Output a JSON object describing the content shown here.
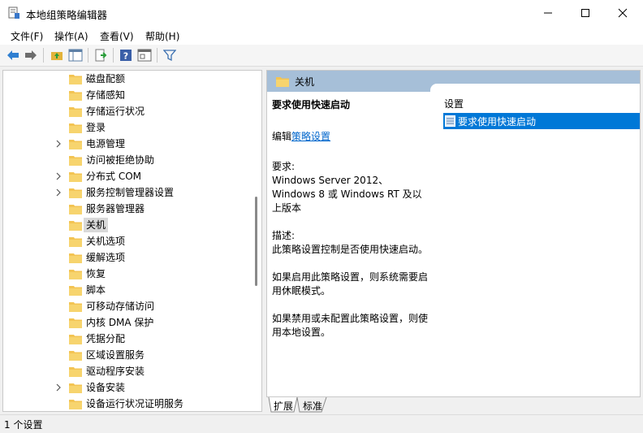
{
  "window": {
    "title": "本地组策略编辑器"
  },
  "menu": [
    {
      "label": "文件(F)"
    },
    {
      "label": "操作(A)"
    },
    {
      "label": "查看(V)"
    },
    {
      "label": "帮助(H)"
    }
  ],
  "tree": {
    "items": [
      {
        "label": "磁盘配额",
        "expandable": false
      },
      {
        "label": "存储感知",
        "expandable": false
      },
      {
        "label": "存储运行状况",
        "expandable": false
      },
      {
        "label": "登录",
        "expandable": false
      },
      {
        "label": "电源管理",
        "expandable": true
      },
      {
        "label": "访问被拒绝协助",
        "expandable": false
      },
      {
        "label": "分布式 COM",
        "expandable": true
      },
      {
        "label": "服务控制管理器设置",
        "expandable": true
      },
      {
        "label": "服务器管理器",
        "expandable": false
      },
      {
        "label": "关机",
        "expandable": false,
        "selected": true
      },
      {
        "label": "关机选项",
        "expandable": false
      },
      {
        "label": "缓解选项",
        "expandable": false
      },
      {
        "label": "恢复",
        "expandable": false
      },
      {
        "label": "脚本",
        "expandable": false
      },
      {
        "label": "可移动存储访问",
        "expandable": false
      },
      {
        "label": "内核 DMA 保护",
        "expandable": false
      },
      {
        "label": "凭据分配",
        "expandable": false
      },
      {
        "label": "区域设置服务",
        "expandable": false
      },
      {
        "label": "驱动程序安装",
        "expandable": false
      },
      {
        "label": "设备安装",
        "expandable": true
      },
      {
        "label": "设备运行状况证明服务",
        "expandable": false
      }
    ]
  },
  "details": {
    "folder_title": "关机",
    "policy_name": "要求使用快速启动",
    "edit_prefix": "编辑",
    "edit_link": "策略设置",
    "requirements_label": "要求:",
    "requirements_text": "Windows Server 2012、Windows 8 或 Windows RT 及以上版本",
    "description_label": "描述:",
    "description_text": "此策略设置控制是否使用快速启动。",
    "enabled_text": "如果启用此策略设置，则系统需要启用休眠模式。",
    "disabled_text": "如果禁用或未配置此策略设置，则使用本地设置。"
  },
  "list": {
    "column_header": "设置",
    "rows": [
      {
        "label": "要求使用快速启动"
      }
    ]
  },
  "tabs": [
    {
      "label": "扩展"
    },
    {
      "label": "标准"
    }
  ],
  "status": {
    "text": "1 个设置"
  },
  "colors": {
    "selection": "#0078d7",
    "header_bar": "#a6bfd8",
    "folder": "#f3c453"
  }
}
